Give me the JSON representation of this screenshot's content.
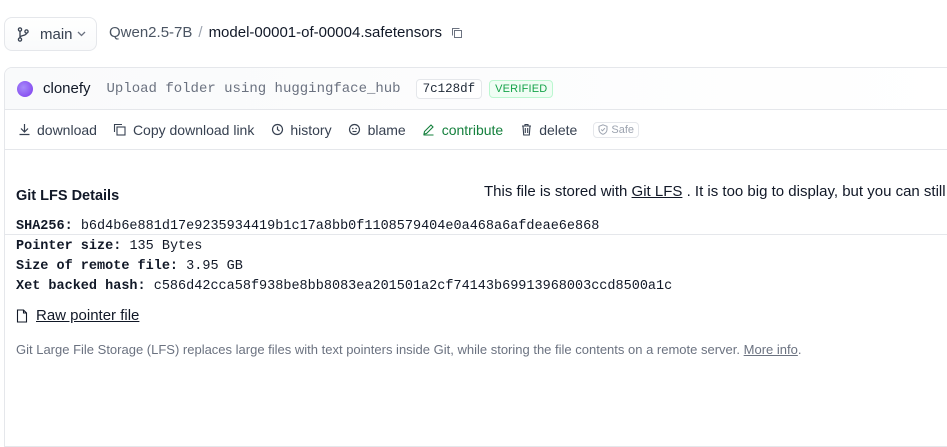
{
  "branch": {
    "name": "main"
  },
  "breadcrumb": {
    "repo": "Qwen2.5-7B",
    "separator": "/",
    "file": "model-00001-of-00004.safetensors"
  },
  "commit": {
    "author": "clonefy",
    "message": "Upload folder using huggingface_hub",
    "sha": "7c128df",
    "verified_label": "VERIFIED"
  },
  "actions": {
    "download": "download",
    "copy_download_link": "Copy download link",
    "history": "history",
    "blame": "blame",
    "contribute": "contribute",
    "delete": "delete",
    "safe": "Safe"
  },
  "notice": {
    "prefix": "This file is stored with ",
    "link": "Git LFS",
    "suffix": " . It is too big to display, but you can still "
  },
  "lfs": {
    "title": "Git LFS Details",
    "sha256_label": "SHA256:",
    "sha256": "b6d4b6e881d17e9235934419b1c17a8bb0f1108579404e0a468a6afdeae6e868",
    "pointer_size_label": "Pointer size:",
    "pointer_size": "135 Bytes",
    "remote_size_label": "Size of remote file:",
    "remote_size": "3.95 GB",
    "xet_hash_label": "Xet backed hash:",
    "xet_hash": "c586d42cca58f938be8bb8083ea201501a2cf74143b69913968003ccd8500a1c",
    "raw_pointer": "Raw pointer file",
    "footnote": "Git Large File Storage (LFS) replaces large files with text pointers inside Git, while storing the file contents on a remote server.",
    "more_info": "More info",
    "footnote_end": "."
  },
  "colors": {
    "contribute": "#15803d",
    "verified": "#16a34a"
  }
}
